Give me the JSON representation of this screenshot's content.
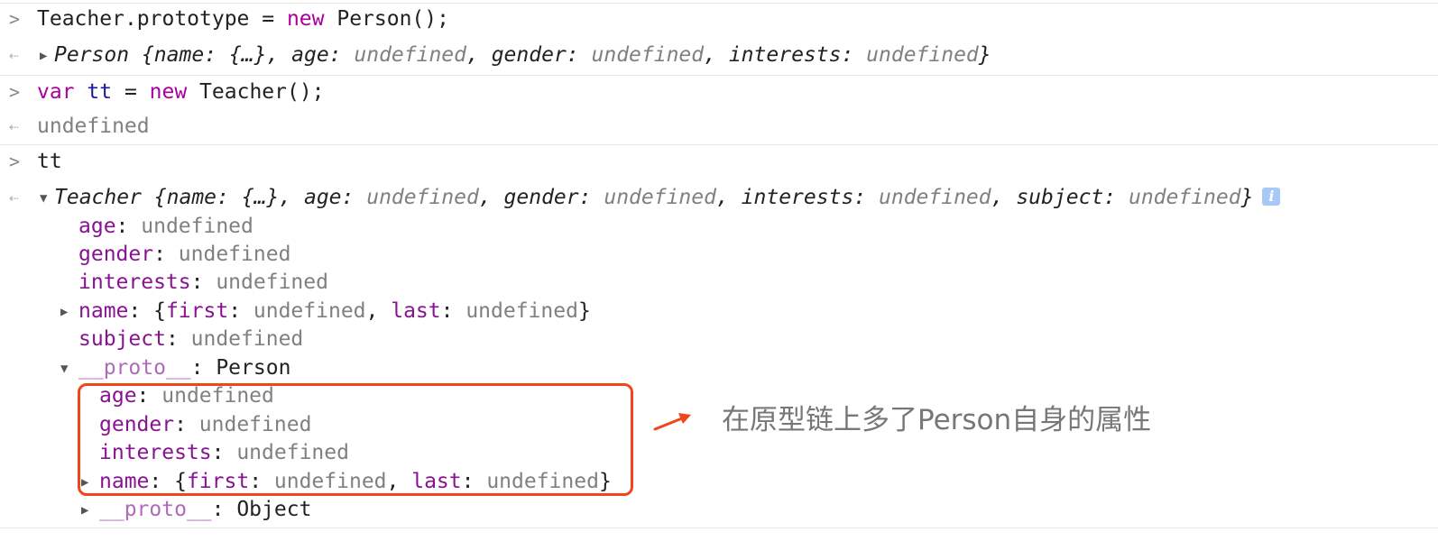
{
  "console": {
    "entry1": {
      "input_object": "Teacher",
      "input_rest": ".prototype = ",
      "input_new": "new",
      "input_ctor": " Person();",
      "output_class": "Person",
      "output_open": " {",
      "output_name_key": "name",
      "output_name_val": ": {…}, ",
      "output_age_key": "age",
      "output_age_val": "undefined",
      "output_gender_key": "gender",
      "output_gender_val": "undefined",
      "output_interests_key": "interests",
      "output_interests_val": "undefined",
      "output_close": "}"
    },
    "entry2": {
      "input_var": "var",
      "input_name": "tt",
      "input_eq": " = ",
      "input_new": "new",
      "input_ctor": " Teacher();",
      "output": "undefined"
    },
    "entry3": {
      "input": "tt",
      "summary_class": "Teacher",
      "summary_open": " {",
      "summary_name_key": "name",
      "summary_name_val": ": {…}, ",
      "summary_age_key": "age",
      "summary_gender_key": "gender",
      "summary_interests_key": "interests",
      "summary_subject_key": "subject",
      "summary_undef": "undefined",
      "summary_close": "}",
      "info_badge": "i",
      "props": [
        {
          "key": "age",
          "value": "undefined"
        },
        {
          "key": "gender",
          "value": "undefined"
        },
        {
          "key": "interests",
          "value": "undefined"
        },
        {
          "key": "name",
          "first_key": "first",
          "last_key": "last",
          "value": "undefined"
        },
        {
          "key": "subject",
          "value": "undefined"
        }
      ],
      "proto": {
        "key": "__proto__",
        "value": "Person",
        "props": [
          {
            "key": "age",
            "value": "undefined"
          },
          {
            "key": "gender",
            "value": "undefined"
          },
          {
            "key": "interests",
            "value": "undefined"
          },
          {
            "key": "name",
            "first_key": "first",
            "last_key": "last",
            "value": "undefined"
          }
        ],
        "inner_proto_key": "__proto__",
        "inner_proto_value": "Object"
      }
    }
  },
  "annotation": {
    "text": "在原型链上多了Person自身的属性",
    "color": "#f2461a"
  },
  "icons": {
    "input_prompt": "chevron-right-icon",
    "output_marker": "result-arrow-icon",
    "expand": "triangle-right-icon",
    "collapse": "triangle-down-icon"
  }
}
